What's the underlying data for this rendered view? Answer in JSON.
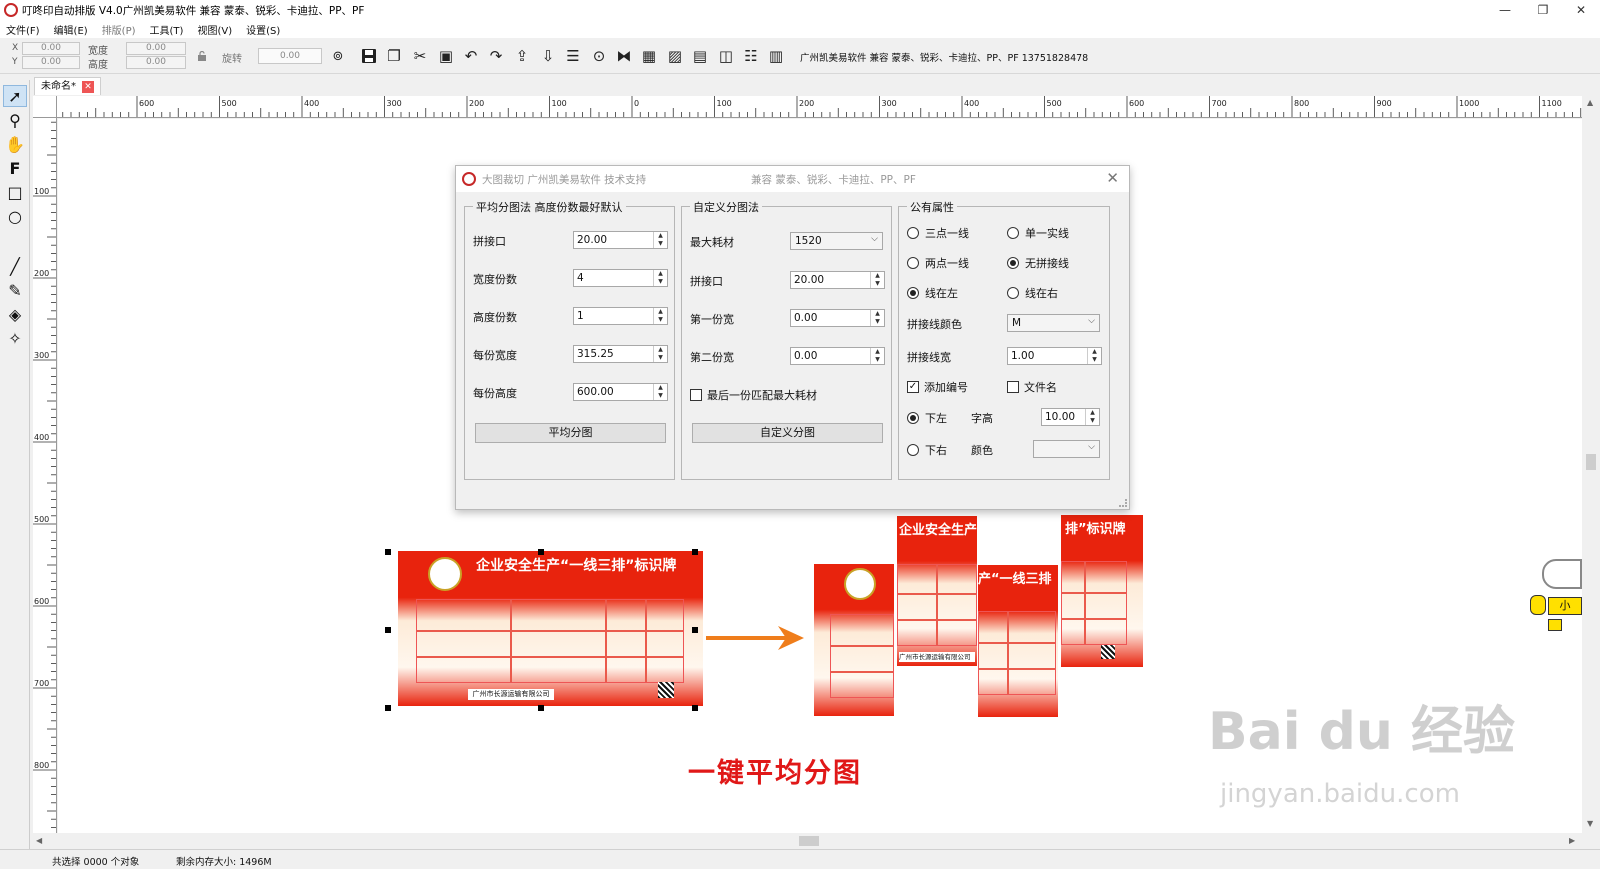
{
  "window": {
    "title": "叮咚印自动排版 V4.0广州凯美易软件 兼容 蒙泰、锐彩、卡迪拉、PP、PF",
    "min": "—",
    "restore": "❐",
    "close": "✕"
  },
  "menu": {
    "items": [
      {
        "label": "文件(F)"
      },
      {
        "label": "编辑(E)"
      },
      {
        "label": "排版(P)"
      },
      {
        "label": "工具(T)"
      },
      {
        "label": "视图(V)"
      },
      {
        "label": "设置(S)"
      }
    ]
  },
  "toolbar": {
    "x_label": "X",
    "y_label": "Y",
    "x_value": "0.00",
    "y_value": "0.00",
    "width_label": "宽度",
    "height_label": "高度",
    "width_value": "0.00",
    "height_value": "0.00",
    "rotate_label": "旋转",
    "rotate_value": "0.00",
    "info": "广州凯美易软件 兼容 蒙泰、锐彩、卡迪拉、PP、PF  13751828478"
  },
  "tab": {
    "label": "未命名*",
    "close": "✕"
  },
  "ruler": {
    "h_labels": [
      "600",
      "500",
      "400",
      "300",
      "200",
      "100",
      "0",
      "100",
      "200",
      "300",
      "400",
      "500",
      "600",
      "700",
      "800",
      "900",
      "1000",
      "1100"
    ],
    "v_labels": [
      "100",
      "200",
      "300",
      "400",
      "500",
      "600",
      "700",
      "800"
    ]
  },
  "dialog": {
    "title": "大图裁切 广州凯美易软件 技术支持",
    "compat": "兼容 蒙泰、锐彩、卡迪拉、PP、PF",
    "close": "✕",
    "avg": {
      "legend": "平均分图法 高度份数最好默认",
      "seam_label": "拼接口",
      "seam_value": "20.00",
      "width_count_label": "宽度份数",
      "width_count_value": "4",
      "height_count_label": "高度份数",
      "height_count_value": "1",
      "piece_width_label": "每份宽度",
      "piece_width_value": "315.25",
      "piece_height_label": "每份高度",
      "piece_height_value": "600.00",
      "button": "平均分图"
    },
    "custom": {
      "legend": "自定义分图法",
      "max_material_label": "最大耗材",
      "max_material_value": "1520",
      "seam_label": "拼接口",
      "seam_value": "20.00",
      "first_width_label": "第一份宽",
      "first_width_value": "0.00",
      "second_width_label": "第二份宽",
      "second_width_value": "0.00",
      "last_match_label": "最后一份匹配最大耗材",
      "button": "自定义分图"
    },
    "common": {
      "legend": "公有属性",
      "three_point": "三点一线",
      "single_line": "单一实线",
      "two_point": "两点一线",
      "no_seam": "无拼接线",
      "line_left": "线在左",
      "line_right": "线在右",
      "seam_color_label": "拼接线颜色",
      "seam_color_value": "M",
      "seam_width_label": "拼接线宽",
      "seam_width_value": "1.00",
      "add_number_label": "添加编号",
      "filename_label": "文件名",
      "bottom_left": "下左",
      "font_height_label": "字高",
      "font_height_value": "10.00",
      "bottom_right": "下右",
      "color_label": "颜色"
    }
  },
  "sign": {
    "title": "企业安全生产“一线三排”标识牌",
    "piece1": "企业安全生产",
    "piece2": "“一线三排”标识牌",
    "piece3": "产“一线三排",
    "piece4": "排”标识牌",
    "company": "广州市长源运输有限公司"
  },
  "caption": "一键平均分图",
  "watermark": {
    "main": "Bai du 经验",
    "sub": "jingyan.baidu.com"
  },
  "side_tag": "小",
  "status": {
    "selection": "共选择 0000 个对象",
    "memory": "剩余内存大小: 1496M"
  },
  "colors": {
    "brand_red": "#e8230d",
    "arrow_orange": "#ef7d1b",
    "caption_red": "#e01818"
  }
}
